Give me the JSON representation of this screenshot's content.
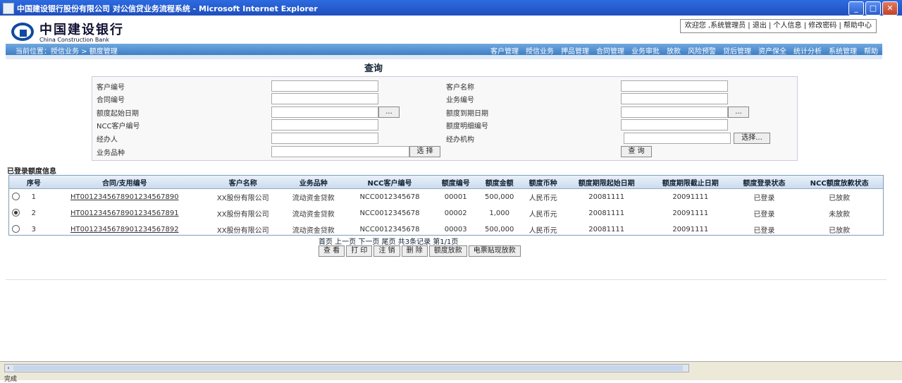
{
  "window": {
    "title": "中国建设银行股份有限公司  对公信贷业务流程系统  -  Microsoft Internet Explorer"
  },
  "header": {
    "logo_cn": "中国建设银行",
    "logo_en": "China Construction Bank",
    "user_info": "欢迎您 ,系统管理员 | 退出 | 个人信息 | 修改密码 | 帮助中心"
  },
  "nav": {
    "breadcrumb": "当前位置：授信业务 > 额度管理",
    "menu": [
      "客户管理",
      "授信业务",
      "押品管理",
      "合同管理",
      "业务审批",
      "放款",
      "风险预警",
      "贷后管理",
      "资产保全",
      "统计分析",
      "系统管理",
      "帮助"
    ]
  },
  "query": {
    "title": "查询",
    "fields": [
      {
        "label": "客户编号",
        "value": ""
      },
      {
        "label": "客户名称",
        "value": ""
      },
      {
        "label": "合同编号",
        "value": ""
      },
      {
        "label": "业务编号",
        "value": ""
      },
      {
        "label": "额度起始日期",
        "value": ""
      },
      {
        "label": "额度到期日期",
        "value": ""
      },
      {
        "label": "NCC客户编号",
        "value": ""
      },
      {
        "label": "额度明细编号",
        "value": ""
      },
      {
        "label": "经办人",
        "value": ""
      },
      {
        "label": "经办机构",
        "value": ""
      },
      {
        "label": "业务品种",
        "value": ""
      }
    ],
    "date_btn": "...",
    "select_btn": "选择...",
    "choose_btn": "选 择",
    "query_btn": "查 询"
  },
  "results": {
    "title": "已登录额度信息",
    "columns": [
      "序号",
      "合同/支用编号",
      "客户名称",
      "业务品种",
      "NCC客户编号",
      "额度编号",
      "额度金额",
      "额度币种",
      "额度期限起始日期",
      "额度期限截止日期",
      "额度登录状态",
      "NCC额度放款状态"
    ],
    "rows": [
      {
        "selected": false,
        "cells": [
          "1",
          "HT0012345678901234567890",
          "XX股份有限公司",
          "流动资金贷款",
          "NCC0012345678",
          "00001",
          "500,000",
          "人民币元",
          "20081111",
          "20091111",
          "已登录",
          "已放款"
        ]
      },
      {
        "selected": true,
        "cells": [
          "2",
          "HT0012345678901234567891",
          "XX股份有限公司",
          "流动资金贷款",
          "NCC0012345678",
          "00002",
          "1,000",
          "人民币元",
          "20081111",
          "20091111",
          "已登录",
          "未放款"
        ]
      },
      {
        "selected": false,
        "cells": [
          "3",
          "HT0012345678901234567892",
          "XX股份有限公司",
          "流动资金贷款",
          "NCC0012345678",
          "00003",
          "500,000",
          "人民币元",
          "20081111",
          "20091111",
          "已登录",
          "已放款"
        ]
      }
    ],
    "pager": "首页 上一页 下一页 尾页   共3条记录 第1/1页",
    "actions": [
      "查 看",
      "打 印",
      "注 销",
      "删 除",
      "额度放款",
      "电票贴现放款"
    ]
  },
  "status": {
    "text": "完成"
  }
}
